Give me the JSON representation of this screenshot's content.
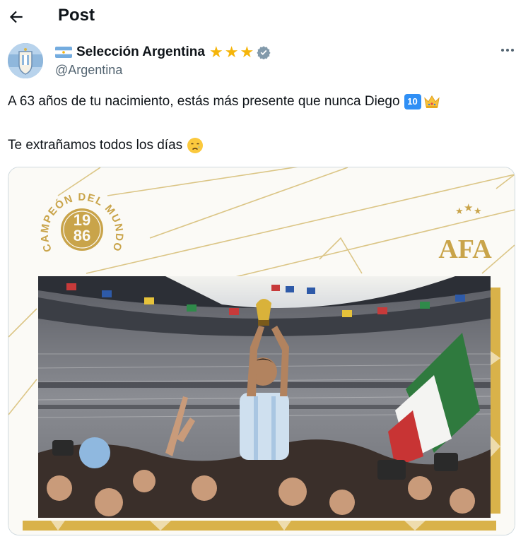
{
  "header": {
    "title": "Post",
    "back_icon": "arrow-left-icon"
  },
  "author": {
    "name": "Selección Argentina",
    "handle": "@Argentina",
    "flag_icon": "argentina-flag-icon",
    "stars": [
      "★",
      "★",
      "★"
    ],
    "verified_icon": "verified-badge-icon",
    "more_icon": "more-horizontal-icon",
    "star_color": "#f5b50a",
    "verified_color": "#829aab"
  },
  "post": {
    "line1": "A 63 años de tu nacimiento, estás más presente que nunca Diego",
    "emoji_ten": "🔟",
    "emoji_ten_label": "10",
    "emoji_crown": "👑",
    "line2": "Te extrañamos todos los días",
    "emoji_sad": "😢"
  },
  "media": {
    "badge_ring_text": "CAMPEÓN DEL MUNDO",
    "badge_year_top": "19",
    "badge_year_bottom": "86",
    "afa_text": "AFA",
    "gold": "#c9a44a"
  }
}
